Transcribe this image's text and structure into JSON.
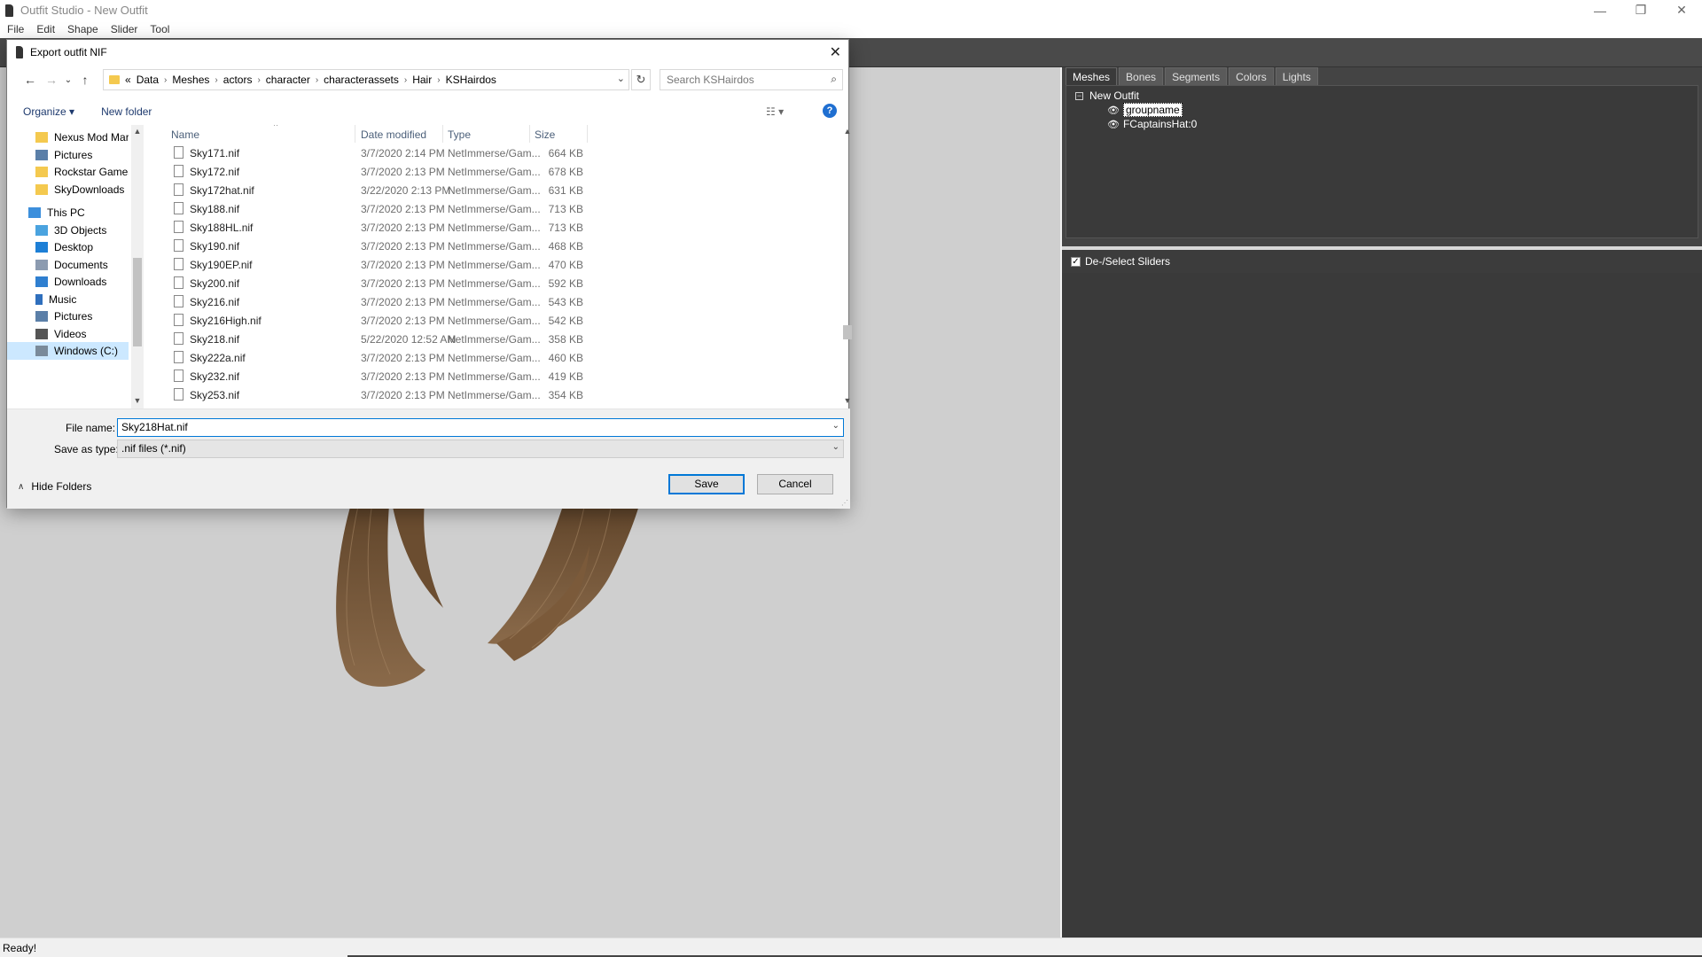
{
  "app": {
    "title": "Outfit Studio - New Outfit",
    "menu": [
      "File",
      "Edit",
      "Shape",
      "Slider",
      "Tool"
    ],
    "window_controls": [
      "—",
      "❐",
      "✕"
    ],
    "status": "Ready!"
  },
  "right_panel": {
    "tabs": [
      "Meshes",
      "Bones",
      "Segments",
      "Colors",
      "Lights"
    ],
    "tree": {
      "root": "New Outfit",
      "items": [
        "groupname",
        "FCaptainsHat:0"
      ]
    },
    "sliders_toggle": "De-/Select Sliders"
  },
  "dialog": {
    "title": "Export outfit NIF",
    "address": {
      "crumbs": [
        "«",
        "Data",
        "Meshes",
        "actors",
        "character",
        "characterassets",
        "Hair",
        "KSHairdos"
      ]
    },
    "search_placeholder": "Search KSHairdos",
    "commands": {
      "organize": "Organize ▾",
      "new_folder": "New folder"
    },
    "nav_items": [
      {
        "label": "Nexus Mod Mar",
        "icon": "folder-icon"
      },
      {
        "label": "Pictures",
        "icon": "pictures-icon"
      },
      {
        "label": "Rockstar Games",
        "icon": "folder-icon"
      },
      {
        "label": "SkyDownloads",
        "icon": "folder-icon"
      },
      {
        "label": "This PC",
        "icon": "pc-icon"
      },
      {
        "label": "3D Objects",
        "icon": "3d-objects-icon"
      },
      {
        "label": "Desktop",
        "icon": "desktop-icon"
      },
      {
        "label": "Documents",
        "icon": "documents-icon"
      },
      {
        "label": "Downloads",
        "icon": "downloads-icon"
      },
      {
        "label": "Music",
        "icon": "music-icon"
      },
      {
        "label": "Pictures",
        "icon": "pictures-icon"
      },
      {
        "label": "Videos",
        "icon": "videos-icon"
      },
      {
        "label": "Windows (C:)",
        "icon": "drive-icon"
      }
    ],
    "columns": [
      "Name",
      "Date modified",
      "Type",
      "Size"
    ],
    "files": [
      {
        "name": "Sky171.nif",
        "date": "3/7/2020 2:14 PM",
        "type": "NetImmerse/Gam...",
        "size": "664 KB"
      },
      {
        "name": "Sky172.nif",
        "date": "3/7/2020 2:13 PM",
        "type": "NetImmerse/Gam...",
        "size": "678 KB"
      },
      {
        "name": "Sky172hat.nif",
        "date": "3/22/2020 2:13 PM",
        "type": "NetImmerse/Gam...",
        "size": "631 KB"
      },
      {
        "name": "Sky188.nif",
        "date": "3/7/2020 2:13 PM",
        "type": "NetImmerse/Gam...",
        "size": "713 KB"
      },
      {
        "name": "Sky188HL.nif",
        "date": "3/7/2020 2:13 PM",
        "type": "NetImmerse/Gam...",
        "size": "713 KB"
      },
      {
        "name": "Sky190.nif",
        "date": "3/7/2020 2:13 PM",
        "type": "NetImmerse/Gam...",
        "size": "468 KB"
      },
      {
        "name": "Sky190EP.nif",
        "date": "3/7/2020 2:13 PM",
        "type": "NetImmerse/Gam...",
        "size": "470 KB"
      },
      {
        "name": "Sky200.nif",
        "date": "3/7/2020 2:13 PM",
        "type": "NetImmerse/Gam...",
        "size": "592 KB"
      },
      {
        "name": "Sky216.nif",
        "date": "3/7/2020 2:13 PM",
        "type": "NetImmerse/Gam...",
        "size": "543 KB"
      },
      {
        "name": "Sky216High.nif",
        "date": "3/7/2020 2:13 PM",
        "type": "NetImmerse/Gam...",
        "size": "542 KB"
      },
      {
        "name": "Sky218.nif",
        "date": "5/22/2020 12:52 AM",
        "type": "NetImmerse/Gam...",
        "size": "358 KB"
      },
      {
        "name": "Sky222a.nif",
        "date": "3/7/2020 2:13 PM",
        "type": "NetImmerse/Gam...",
        "size": "460 KB"
      },
      {
        "name": "Sky232.nif",
        "date": "3/7/2020 2:13 PM",
        "type": "NetImmerse/Gam...",
        "size": "419 KB"
      },
      {
        "name": "Sky253.nif",
        "date": "3/7/2020 2:13 PM",
        "type": "NetImmerse/Gam...",
        "size": "354 KB"
      }
    ],
    "file_name_label": "File name:",
    "file_name_value": "Sky218Hat.nif",
    "save_type_label": "Save as type:",
    "save_type_value": ".nif files (*.nif)",
    "hide_folders": "Hide Folders",
    "save": "Save",
    "cancel": "Cancel"
  },
  "colors": {
    "accent": "#0078d7",
    "panel_dark": "#3a3a3a",
    "viewport": "#cfcfcf",
    "hair": "#7a5a3a"
  }
}
